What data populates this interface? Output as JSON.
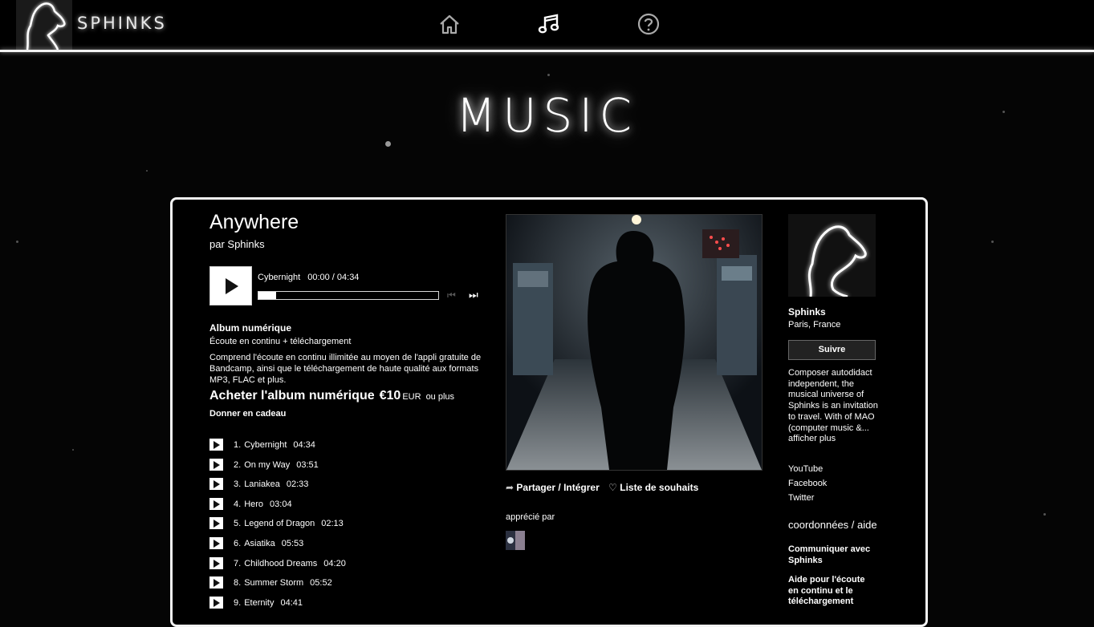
{
  "brand": "SPHINKS",
  "nav": {
    "home_icon": "home-icon",
    "music_icon": "music-note-icon",
    "help_icon": "question-circle-icon"
  },
  "page_title": "MUSIC",
  "album": {
    "title": "Anywhere",
    "by_prefix": "par ",
    "artist": "Sphinks"
  },
  "player": {
    "track": "Cybernight",
    "time": "00:00 / 04:34",
    "progress_fraction": 0.1
  },
  "purchase": {
    "heading": "Album numérique",
    "subheading": "Écoute en continu + téléchargement",
    "description": "Comprend l'écoute en continu illimitée au moyen de l'appli gratuite de Bandcamp, ainsi que le téléchargement de haute qualité aux formats MP3, FLAC et plus.",
    "buy_label": "Acheter l'album numérique",
    "price": "€10",
    "currency": "EUR",
    "or_more": "ou plus",
    "gift_label": "Donner en cadeau"
  },
  "tracks": [
    {
      "num": "1.",
      "title": "Cybernight",
      "duration": "04:34"
    },
    {
      "num": "2.",
      "title": "On my Way",
      "duration": "03:51"
    },
    {
      "num": "3.",
      "title": "Laniakea",
      "duration": "02:33"
    },
    {
      "num": "4.",
      "title": "Hero",
      "duration": "03:04"
    },
    {
      "num": "5.",
      "title": "Legend of Dragon",
      "duration": "02:13"
    },
    {
      "num": "6.",
      "title": "Asiatika",
      "duration": "05:53"
    },
    {
      "num": "7.",
      "title": "Childhood Dreams",
      "duration": "04:20"
    },
    {
      "num": "8.",
      "title": "Summer Storm",
      "duration": "05:52"
    },
    {
      "num": "9.",
      "title": "Eternity",
      "duration": "04:41"
    }
  ],
  "share": {
    "share_label": "Partager / Intégrer",
    "wishlist_label": "Liste de souhaits"
  },
  "liked_by": "apprécié par",
  "artist_panel": {
    "name": "Sphinks",
    "location": "Paris, France",
    "follow_label": "Suivre",
    "bio": "Composer autodidact independent, the musical universe of Sphinks is an invitation to travel. With of MAO (computer music &...",
    "more_label": "afficher plus",
    "links": [
      "YouTube",
      "Facebook",
      "Twitter"
    ],
    "contact_heading": "coordonnées / aide",
    "contact_link": "Communiquer avec Sphinks",
    "help_link": "Aide pour l'écoute en continu et le téléchargement"
  }
}
